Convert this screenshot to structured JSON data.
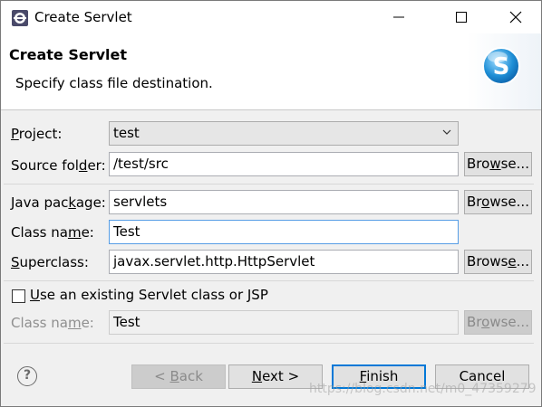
{
  "window": {
    "title": "Create Servlet",
    "minimize_symbol": "minimize",
    "maximize_symbol": "maximize",
    "close_symbol": "close"
  },
  "banner": {
    "title": "Create Servlet",
    "description": "Specify class file destination.",
    "logo_letter": "S"
  },
  "form": {
    "project": {
      "label_pre": "",
      "label_ul": "P",
      "label_post": "roject:",
      "value": "test"
    },
    "source_folder": {
      "label_pre": "Source fol",
      "label_ul": "d",
      "label_post": "er:",
      "value": "/test/src",
      "browse_pre": "Bro",
      "browse_ul": "w",
      "browse_post": "se..."
    },
    "java_package": {
      "label_pre": "Java pac",
      "label_ul": "k",
      "label_post": "age:",
      "value": "servlets",
      "browse_pre": "Br",
      "browse_ul": "o",
      "browse_post": "wse..."
    },
    "class_name": {
      "label_pre": "Class na",
      "label_ul": "m",
      "label_post": "e:",
      "value": "Test"
    },
    "superclass": {
      "label_pre": "",
      "label_ul": "S",
      "label_post": "uperclass:",
      "value": "javax.servlet.http.HttpServlet",
      "browse_pre": "Brows",
      "browse_ul": "e",
      "browse_post": "..."
    },
    "existing": {
      "label_pre": "",
      "label_ul": "U",
      "label_post": "se an existing Servlet class or JSP",
      "checked": false
    },
    "existing_class_name": {
      "label_pre": "Class na",
      "label_ul": "m",
      "label_post": "e:",
      "value": "Test",
      "browse_pre": "Br",
      "browse_ul": "o",
      "browse_post": "wse..."
    }
  },
  "footer": {
    "help_symbol": "?",
    "back_pre": "< ",
    "back_ul": "B",
    "back_post": "ack",
    "next_pre": "",
    "next_ul": "N",
    "next_post": "ext >",
    "finish_pre": "",
    "finish_ul": "F",
    "finish_post": "inish",
    "cancel_label": "Cancel"
  },
  "watermark": "https://blog.csdn.net/m0_47359279",
  "colors": {
    "focus": "#569de5",
    "default_button": "#0078d7",
    "logo": "#1f8fd6"
  }
}
